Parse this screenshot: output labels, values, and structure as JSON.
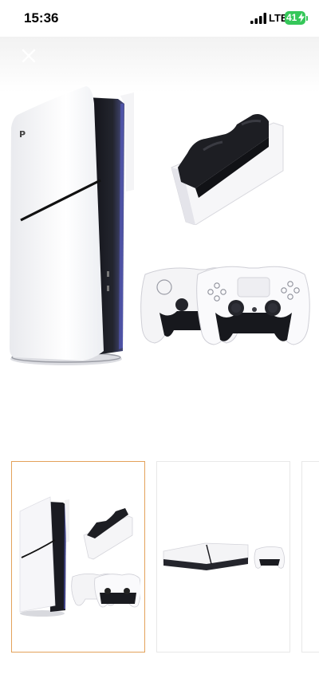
{
  "status_bar": {
    "time": "15:36",
    "network": "LTE",
    "battery": "41",
    "battery_charging": true,
    "icons": [
      "signal-bars-icon",
      "battery-icon",
      "charging-bolt-icon"
    ]
  },
  "gallery": {
    "close_icon": "close-icon",
    "main_image": [
      "console-image",
      "charging-station-image",
      "controllers-image"
    ],
    "thumbnails": [
      {
        "selected": true
      },
      {
        "selected": false
      },
      {
        "selected": false
      }
    ]
  },
  "colors": {
    "accent_border": "#e3a25a",
    "battery_green": "#35c759",
    "console_black": "#1c1d22",
    "console_white": "#f7f7f9"
  }
}
